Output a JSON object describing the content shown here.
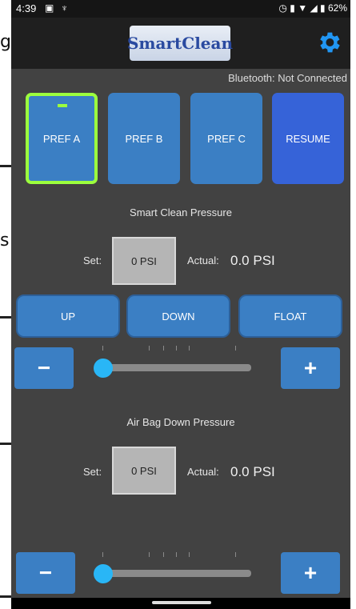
{
  "background": {
    "fragments": [
      "g",
      "s"
    ]
  },
  "status_bar": {
    "time": "4:39",
    "icons_left": [
      "image-icon",
      "trophy-icon"
    ],
    "icons_right": [
      "alarm-icon",
      "vibrate-icon",
      "wifi-icon",
      "signal-icon",
      "battery-icon"
    ],
    "battery": "62%"
  },
  "app_bar": {
    "logo_text": "SmartClean",
    "settings_icon": "gear-icon"
  },
  "bluetooth_status": "Bluetooth: Not Connected",
  "prefs": [
    {
      "label": "PREF A",
      "active": true
    },
    {
      "label": "PREF B",
      "active": false
    },
    {
      "label": "PREF C",
      "active": false
    },
    {
      "label": "RESUME",
      "active": false
    }
  ],
  "smart_clean": {
    "title": "Smart Clean Pressure",
    "set_label": "Set:",
    "set_value": "0 PSI",
    "actual_label": "Actual:",
    "actual_value": "0.0 PSI",
    "slider_value": 0
  },
  "modes": [
    "UP",
    "DOWN",
    "FLOAT"
  ],
  "steppers": {
    "minus": "−",
    "plus": "+"
  },
  "air_bag": {
    "title": "Air Bag Down Pressure",
    "set_label": "Set:",
    "set_value": "0 PSI",
    "actual_label": "Actual:",
    "actual_value": "0.0 PSI",
    "slider_value": 0
  },
  "colors": {
    "accent": "#3b7fc4",
    "resume": "#3663d8",
    "active_border": "#9cff3d",
    "slider_thumb": "#29b6f6"
  }
}
